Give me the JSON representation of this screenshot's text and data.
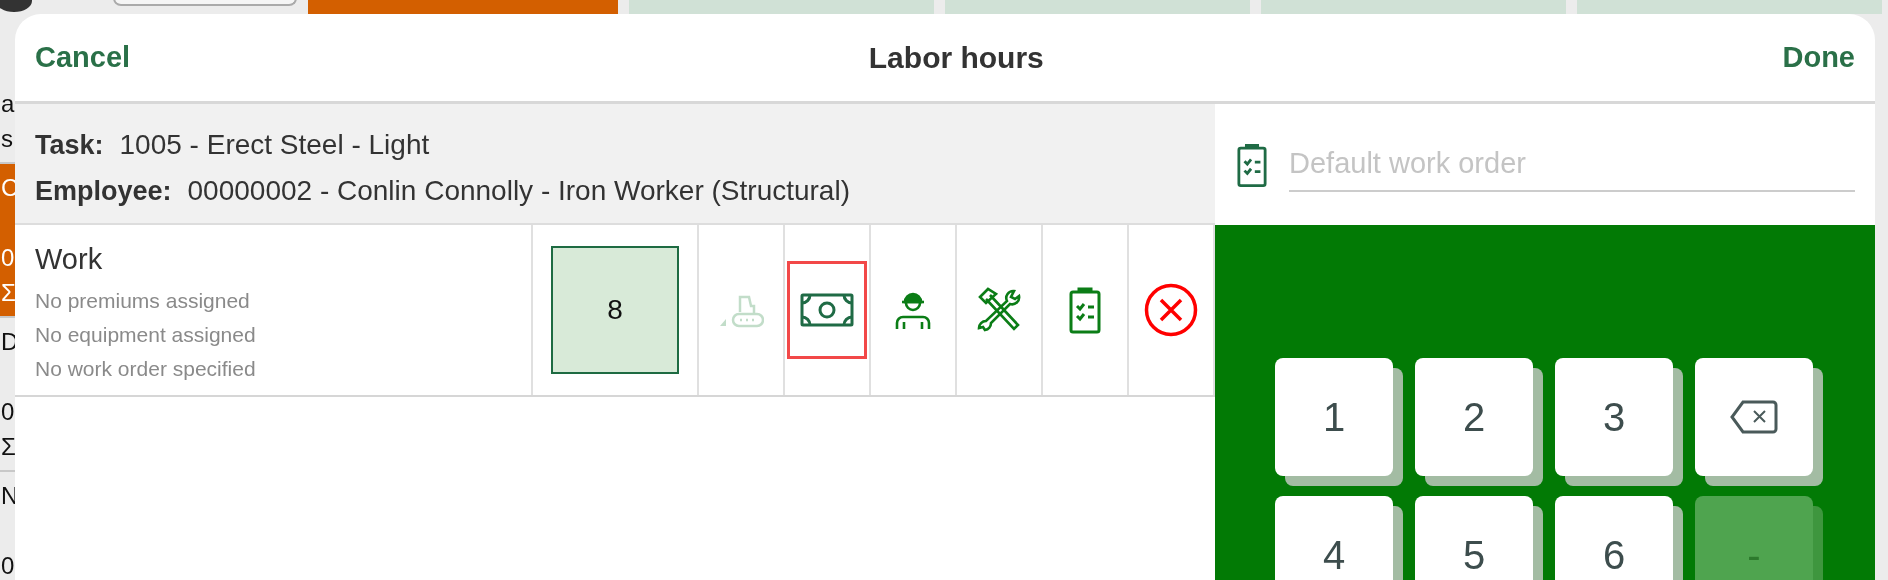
{
  "background": {
    "left_strip": [
      {
        "kind": "plain",
        "texts": [
          "a",
          "s"
        ]
      },
      {
        "kind": "highlight",
        "texts": [
          "C",
          "0",
          "Σ"
        ]
      },
      {
        "kind": "plain",
        "texts": [
          "D",
          "0",
          "Σ"
        ]
      },
      {
        "kind": "plain",
        "texts": [
          "N",
          "0"
        ]
      }
    ]
  },
  "dialog": {
    "title": "Labor hours",
    "cancel": "Cancel",
    "done": "Done",
    "task": {
      "label": "Task:",
      "value": "1005 - Erect Steel - Light"
    },
    "employee": {
      "label": "Employee:",
      "value": "00000002 - Conlin Connolly - Iron Worker (Structural)"
    },
    "entry": {
      "name": "Work",
      "details": [
        "No premiums assigned",
        "No equipment assigned",
        "No work order specified"
      ],
      "hours": "8",
      "actions": [
        {
          "kind": "equipment",
          "disabled": true,
          "selected": false
        },
        {
          "kind": "premium",
          "disabled": false,
          "selected": true
        },
        {
          "kind": "worker",
          "disabled": false,
          "selected": false
        },
        {
          "kind": "tools",
          "disabled": false,
          "selected": false
        },
        {
          "kind": "work-order",
          "disabled": false,
          "selected": false
        },
        {
          "kind": "delete",
          "disabled": false,
          "selected": false
        }
      ]
    },
    "work_order": {
      "placeholder": "Default work order"
    },
    "keypad": [
      {
        "kind": "digit",
        "label": "1",
        "disabled": false
      },
      {
        "kind": "digit",
        "label": "2",
        "disabled": false
      },
      {
        "kind": "digit",
        "label": "3",
        "disabled": false
      },
      {
        "kind": "backspace",
        "disabled": false
      },
      {
        "kind": "digit",
        "label": "4",
        "disabled": false
      },
      {
        "kind": "digit",
        "label": "5",
        "disabled": false
      },
      {
        "kind": "digit",
        "label": "6",
        "disabled": false
      },
      {
        "kind": "digit",
        "label": "-",
        "disabled": true
      }
    ]
  }
}
